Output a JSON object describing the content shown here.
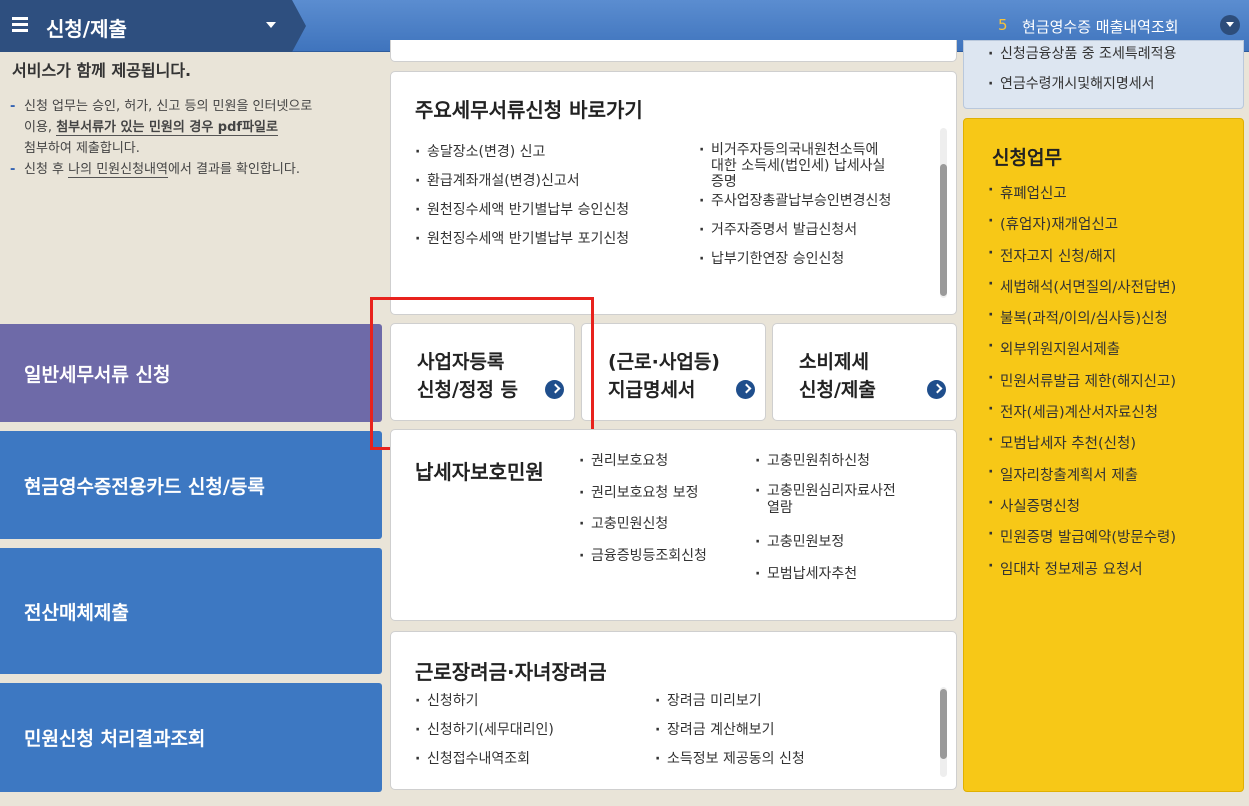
{
  "topbar": {
    "menu_title": "신청/제출",
    "right_number": "5",
    "right_label": "현금영수증 매출내역조회"
  },
  "intro": {
    "heading": "서비스가 함께 제공됩니다.",
    "line1_a": "신청 업무는 승인, 허가, 신고 등의 민원을 인터넷으로",
    "line1_b": "이용, ",
    "line1_bold": "첨부서류가 있는 민원의 경우 pdf파일로",
    "line1_c": "첨부하여 제출합니다.",
    "line2_a": "신청 후 ",
    "line2_u": "나의 민원신청내역",
    "line2_b": "에서 결과를 확인합니다."
  },
  "left_nav": {
    "item1": "일반세무서류 신청",
    "item2": "현금영수증전용카드 신청/등록",
    "item3": "전산매체제출",
    "item4": "민원신청 처리결과조회"
  },
  "main_card": {
    "title": "주요세무서류신청 바로가기",
    "col1": [
      "송달장소(변경) 신고",
      "환급계좌개설(변경)신고서",
      "원천징수세액 반기별납부 승인신청",
      "원천징수세액 반기별납부 포기신청"
    ],
    "col2_first": [
      "비거주자등의국내원천소득에",
      "대한 소득세(법인세) 납세사실",
      "증명"
    ],
    "col2": [
      "주사업장총괄납부승인변경신청",
      "거주자증명서 발급신청서",
      "납부기한연장 승인신청"
    ]
  },
  "buttons": {
    "b1_line1": "사업자등록",
    "b1_line2": "신청/정정 등",
    "b2_line1": "(근로·사업등)",
    "b2_line2": "지급명세서",
    "b3_line1": "소비제세",
    "b3_line2": "신청/제출"
  },
  "protect_card": {
    "title": "납세자보호민원",
    "col1": [
      "권리보호요청",
      "권리보호요청 보정",
      "고충민원신청",
      "금융증빙등조회신청"
    ],
    "col2_first": [
      "고충민원취하신청"
    ],
    "col2_wrap": [
      "고충민원심리자료사전",
      "열람"
    ],
    "col2": [
      "고충민원보정",
      "모범납세자추천"
    ]
  },
  "work_card": {
    "title": "근로장려금·자녀장려금",
    "col1": [
      "신청하기",
      "신청하기(세무대리인)",
      "신청접수내역조회"
    ],
    "col2": [
      "장려금 미리보기",
      "장려금 계산해보기",
      "소득정보 제공동의 신청"
    ]
  },
  "right_top": {
    "items": [
      "신청금융상품 중 조세특례적용",
      "연금수령개시및해지명세서"
    ]
  },
  "right_yellow": {
    "title": "신청업무",
    "items": [
      "휴폐업신고",
      "(휴업자)재개업신고",
      "전자고지 신청/해지",
      "세법해석(서면질의/사전답변)",
      "불복(과적/이의/심사등)신청",
      "외부위원지원서제출",
      "민원서류발급 제한(해지신고)",
      "전자(세금)계산서자료신청",
      "모범납세자 추천(신청)",
      "일자리창출계획서 제출",
      "사실증명신청",
      "민원증명 발급예약(방문수령)",
      "임대차 정보제공 요청서"
    ]
  },
  "colors": {
    "topbar": "#4a80c7",
    "menu_dark": "#2e4f7f",
    "nav_purple": "#6e6aa8",
    "nav_blue": "#3d78c2",
    "yellow_panel": "#f7c817",
    "highlight": "#e8221d"
  }
}
